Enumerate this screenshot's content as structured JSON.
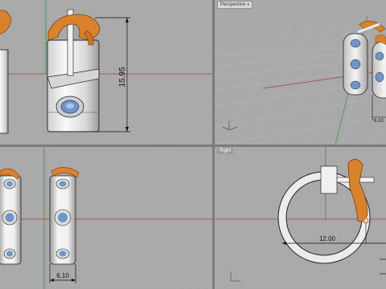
{
  "viewports": {
    "top_left": {
      "label": "",
      "dimension": "15.95"
    },
    "top_right": {
      "label": "Perspective",
      "caret": "▾",
      "dimension": "6.10"
    },
    "bottom_left": {
      "label": "",
      "dimension": "6.10"
    },
    "bottom_right": {
      "label": "Right",
      "dimension": "12.00"
    }
  },
  "colors": {
    "background": "#a9a9a9",
    "grid_minor": "#b4b4b4",
    "grid_major": "#9c9c9c",
    "axis_x": "#9e4040",
    "axis_y": "#3f8f3f",
    "metal": "#e6e6e6",
    "orange_clip": "#d9822e",
    "gem": "#6f95c8"
  },
  "icons": [
    "axes-gizmo-icon"
  ]
}
